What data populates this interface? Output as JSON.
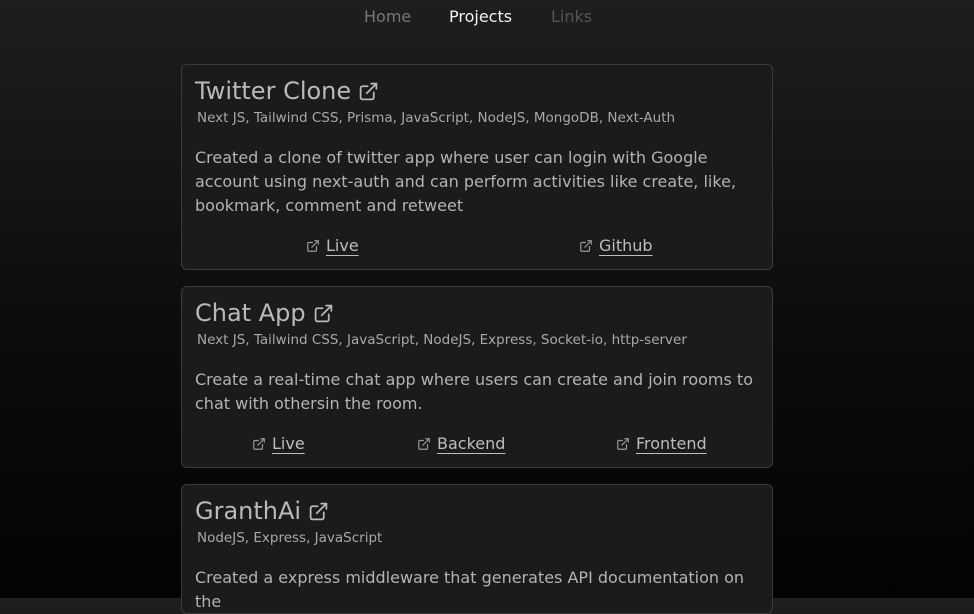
{
  "nav": {
    "home": "Home",
    "projects": "Projects",
    "links": "Links"
  },
  "projects": [
    {
      "title": "Twitter Clone",
      "tech": "Next JS, Tailwind CSS, Prisma, JavaScript, NodeJS, MongoDB, Next-Auth",
      "description": "Created a clone of twitter app where user can login with Google account using next-auth and can perform activities like create, like, bookmark, comment and retweet",
      "links": [
        "Live",
        "Github"
      ]
    },
    {
      "title": "Chat App",
      "tech": "Next JS, Tailwind CSS, JavaScript, NodeJS, Express, Socket-io, http-server",
      "description": "Create a real-time chat app where users can create and join rooms to chat with othersin the room.",
      "links": [
        "Live",
        "Backend",
        "Frontend"
      ]
    },
    {
      "title": "GranthAi",
      "tech": "NodeJS, Express, JavaScript",
      "description": "Created a express middleware that generates API documentation on the"
    }
  ],
  "icons": {
    "external_link": "external-link-icon"
  }
}
